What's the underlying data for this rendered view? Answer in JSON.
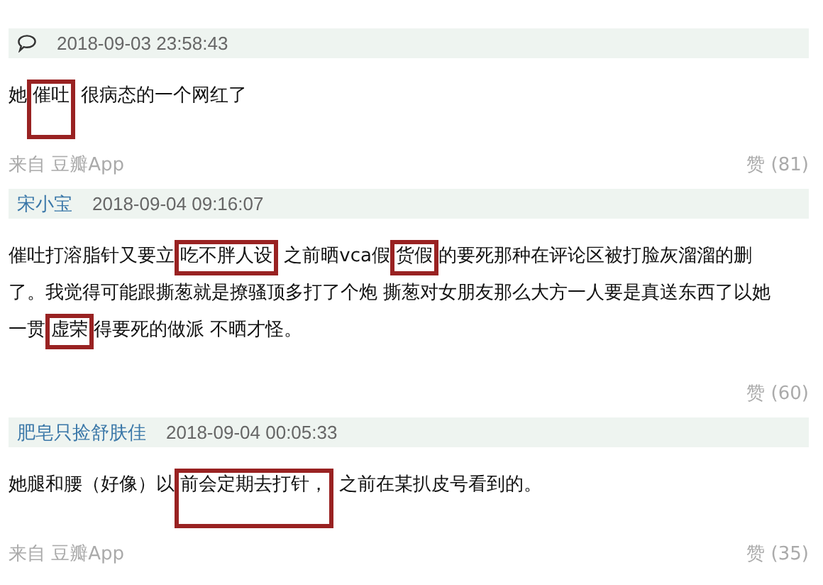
{
  "comments": [
    {
      "time": "2018-09-03 23:58:43",
      "content": [
        {
          "text": "她",
          "marked": false
        },
        {
          "text": "催吐",
          "marked": true
        },
        {
          "text": " 很病态的一个网红了",
          "marked": false
        }
      ],
      "source": "来自 豆瓣App",
      "likes": "赞 (81)"
    },
    {
      "author": "宋小宝",
      "time": "2018-09-04 09:16:07",
      "content": [
        {
          "text": "催吐打溶脂针又要立",
          "marked": false
        },
        {
          "text": "吃不胖人设",
          "marked": true
        },
        {
          "text": " 之前晒vca假",
          "marked": false
        },
        {
          "text": "货假",
          "marked": true
        },
        {
          "text": "的要死那种在评论区被打脸灰溜溜的删了。我觉得可能跟撕葱就是撩骚顶多打了个炮 撕葱对女朋友那么大方一人要是真送东西了以她一贯",
          "marked": false
        },
        {
          "text": "虚荣",
          "marked": true
        },
        {
          "text": "得要死的做派 不晒才怪。",
          "marked": false
        }
      ],
      "likes": "赞 (60)"
    },
    {
      "author": "肥皂只捡舒肤佳",
      "time": "2018-09-04 00:05:33",
      "content": [
        {
          "text": "她腿和腰（好像）以",
          "marked": false
        },
        {
          "text": "前会定期去打针，",
          "marked": true
        },
        {
          "text": " 之前在某扒皮号看到的。",
          "marked": false
        }
      ],
      "source": "来自 豆瓣App",
      "likes": "赞 (35)"
    }
  ]
}
